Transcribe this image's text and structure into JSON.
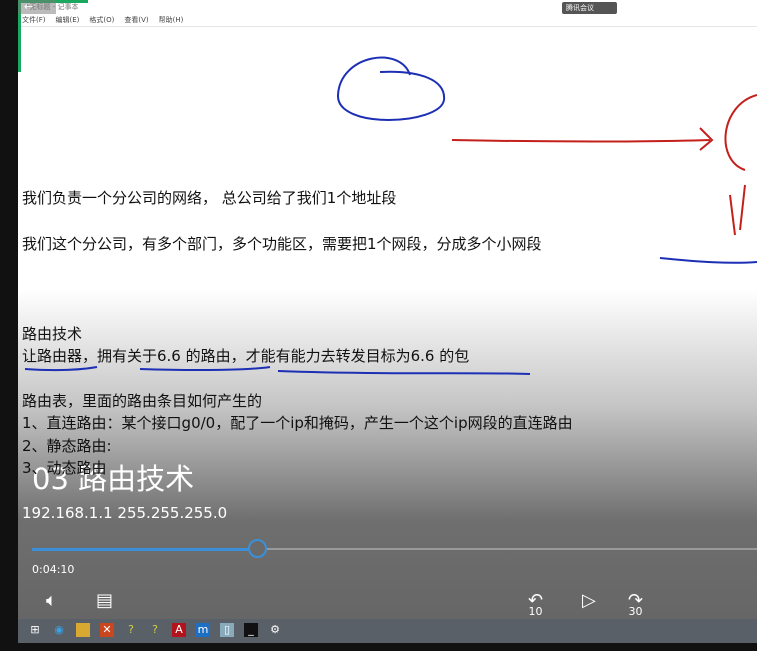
{
  "window": {
    "title": "*无标题 - 记事本",
    "menu": [
      "文件(F)",
      "编辑(E)",
      "格式(O)",
      "查看(V)",
      "帮助(H)"
    ],
    "meeting_badge": "腾讯会议"
  },
  "content": {
    "lines": [
      "我们负责一个分公司的网络， 总公司给了我们1个地址段",
      "我们这个分公司，有多个部门，多个功能区，需要把1个网段，分成多个小网段",
      "路由技术",
      "让路由器，拥有关于6.6 的路由，才能有能力去转发目标为6.6 的包",
      "路由表，里面的路由条目如何产生的",
      "1、直连路由：某个接口g0/0，配了一个ip和掩码，产生一个这个ip网段的直连路由",
      "2、静态路由:",
      "3、动态路由"
    ],
    "ip_line": "192.168.1.1 255.255.255.0"
  },
  "player": {
    "video_title": "03 路由技术",
    "current_time": "0:04:10",
    "progress": 0.31,
    "rewind_label": "10",
    "forward_label": "30",
    "accent": "#3b8fd9"
  },
  "taskbar": {
    "icons": [
      "start-icon",
      "edge-icon",
      "folder-icon",
      "xmind-icon",
      "tool-icon",
      "tool2-icon",
      "pdf-icon",
      "app-icon",
      "tablet-icon",
      "terminal-icon",
      "settings-icon"
    ]
  }
}
